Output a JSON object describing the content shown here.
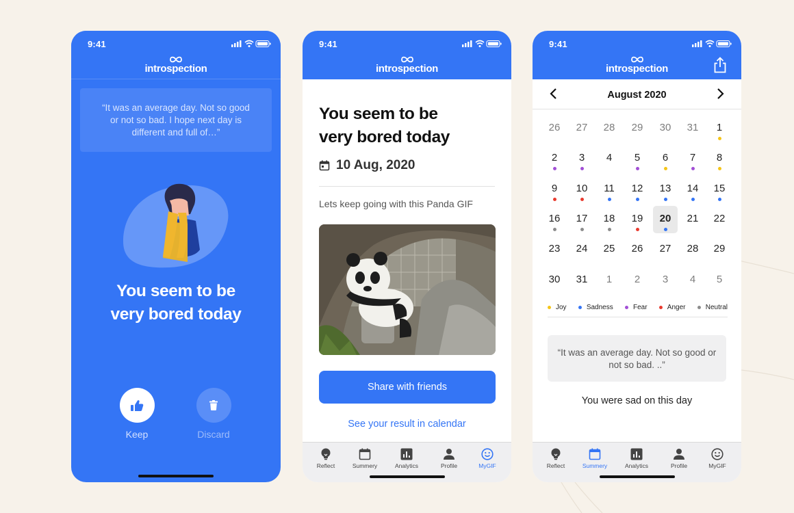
{
  "colors": {
    "brand_blue": "#3475f5",
    "background": "#f7f2ea",
    "joy": "#f5c518",
    "sadness": "#3475f5",
    "fear": "#a24fd6",
    "anger": "#e93a2e",
    "neutral": "#8c8c8c"
  },
  "brand": {
    "name": "introspection"
  },
  "status_time": "9:41",
  "phone1": {
    "quote": "“It was an average day. Not so good or not so bad. I hope next day is different and full of…”",
    "heading_line1": "You seem to be",
    "heading_line2": "very bored today",
    "keep_label": "Keep",
    "discard_label": "Discard"
  },
  "phone2": {
    "heading_line1": "You seem to be",
    "heading_line2": "very bored today",
    "date": "10 Aug, 2020",
    "subtitle": "Lets keep going with this Panda GIF",
    "share_button": "Share with friends",
    "calendar_link": "See your result in calendar",
    "tabs": [
      {
        "label": "Reflect",
        "icon": "lightbulb-icon"
      },
      {
        "label": "Summery",
        "icon": "calendar-icon"
      },
      {
        "label": "Analytics",
        "icon": "bar-chart-icon"
      },
      {
        "label": "Profile",
        "icon": "profile-icon"
      },
      {
        "label": "MyGIF",
        "icon": "smiley-icon",
        "active": true
      }
    ]
  },
  "phone3": {
    "month": "August 2020",
    "days": [
      {
        "n": "26",
        "muted": true
      },
      {
        "n": "27",
        "muted": true
      },
      {
        "n": "28",
        "muted": true
      },
      {
        "n": "29",
        "muted": true
      },
      {
        "n": "30",
        "muted": true
      },
      {
        "n": "31",
        "muted": true
      },
      {
        "n": "1",
        "mood": "joy"
      },
      {
        "n": "2",
        "mood": "fear"
      },
      {
        "n": "3",
        "mood": "fear"
      },
      {
        "n": "4"
      },
      {
        "n": "5",
        "mood": "fear"
      },
      {
        "n": "6",
        "mood": "joy"
      },
      {
        "n": "7",
        "mood": "fear"
      },
      {
        "n": "8",
        "mood": "joy"
      },
      {
        "n": "9",
        "mood": "anger"
      },
      {
        "n": "10",
        "mood": "anger"
      },
      {
        "n": "11",
        "mood": "sadness"
      },
      {
        "n": "12",
        "mood": "sadness"
      },
      {
        "n": "13",
        "mood": "sadness"
      },
      {
        "n": "14",
        "mood": "sadness"
      },
      {
        "n": "15",
        "mood": "sadness"
      },
      {
        "n": "16",
        "mood": "neutral"
      },
      {
        "n": "17",
        "mood": "neutral"
      },
      {
        "n": "18",
        "mood": "neutral"
      },
      {
        "n": "19",
        "mood": "anger"
      },
      {
        "n": "20",
        "mood": "sadness",
        "selected": true
      },
      {
        "n": "21"
      },
      {
        "n": "22"
      },
      {
        "n": "23"
      },
      {
        "n": "24"
      },
      {
        "n": "25"
      },
      {
        "n": "26"
      },
      {
        "n": "27"
      },
      {
        "n": "28"
      },
      {
        "n": "29"
      },
      {
        "n": "30"
      },
      {
        "n": "31"
      },
      {
        "n": "1",
        "muted": true
      },
      {
        "n": "2",
        "muted": true
      },
      {
        "n": "3",
        "muted": true
      },
      {
        "n": "4",
        "muted": true
      },
      {
        "n": "5",
        "muted": true
      }
    ],
    "legend": [
      {
        "label": "Joy",
        "mood": "joy"
      },
      {
        "label": "Sadness",
        "mood": "sadness"
      },
      {
        "label": "Fear",
        "mood": "fear"
      },
      {
        "label": "Anger",
        "mood": "anger"
      },
      {
        "label": "Neutral",
        "mood": "neutral"
      }
    ],
    "quote": "“It was an average day. Not so good or not so bad. ..”",
    "status": "You were sad on this day",
    "tabs": [
      {
        "label": "Reflect",
        "icon": "lightbulb-icon"
      },
      {
        "label": "Summery",
        "icon": "calendar-icon",
        "active": true
      },
      {
        "label": "Analytics",
        "icon": "bar-chart-icon"
      },
      {
        "label": "Profile",
        "icon": "profile-icon"
      },
      {
        "label": "MyGIF",
        "icon": "smiley-icon"
      }
    ]
  }
}
